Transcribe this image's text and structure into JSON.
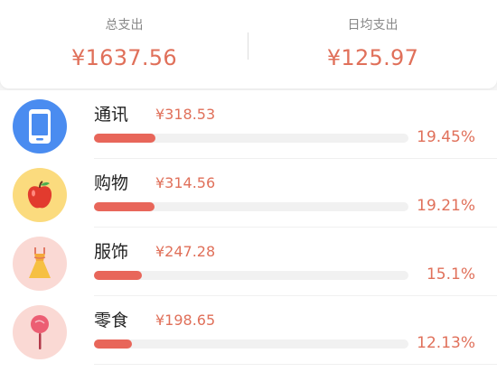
{
  "summary": {
    "total_label": "总支出",
    "total_value": "¥1637.56",
    "daily_label": "日均支出",
    "daily_value": "¥125.97"
  },
  "colors": {
    "accent": "#e0705a",
    "bar": "#e8665a",
    "track": "#f1f1f1"
  },
  "categories": [
    {
      "name": "通讯",
      "amount": "¥318.53",
      "percent": "19.45%",
      "fraction": 0.1945,
      "icon": "phone-icon",
      "icon_bg": "#4a8cf0"
    },
    {
      "name": "购物",
      "amount": "¥314.56",
      "percent": "19.21%",
      "fraction": 0.1921,
      "icon": "apple-icon",
      "icon_bg": "#fbdb7e"
    },
    {
      "name": "服饰",
      "amount": "¥247.28",
      "percent": "15.1%",
      "fraction": 0.151,
      "icon": "dress-icon",
      "icon_bg": "#fad9d4"
    },
    {
      "name": "零食",
      "amount": "¥198.65",
      "percent": "12.13%",
      "fraction": 0.1213,
      "icon": "lollipop-icon",
      "icon_bg": "#fad9d4"
    }
  ]
}
